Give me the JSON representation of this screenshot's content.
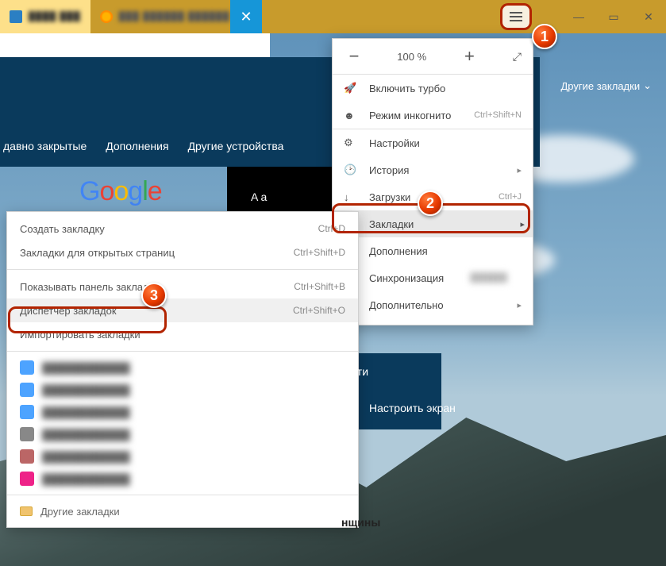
{
  "window": {
    "minimize": "—",
    "maximize": "▭",
    "close": "✕"
  },
  "hamburger_tooltip": "Меню",
  "tab_close_glyph": "✕",
  "zoom": {
    "minus": "−",
    "value": "100 %",
    "plus": "+",
    "full": "⤢"
  },
  "main_menu": {
    "turbo": {
      "icon": "🚀",
      "label": "Включить турбо"
    },
    "incognito": {
      "icon": "☻",
      "label": "Режим инкогнито",
      "sc": "Ctrl+Shift+N"
    },
    "settings": {
      "icon": "⚙",
      "label": "Настройки"
    },
    "history": {
      "icon": "🕑",
      "label": "История"
    },
    "downloads": {
      "icon": "↓",
      "label": "Загрузки",
      "sc": "Ctrl+J"
    },
    "bookmarks": {
      "icon": "☆",
      "label": "Закладки"
    },
    "addons": {
      "icon": "▦",
      "label": "Дополнения"
    },
    "sync": {
      "icon": "⟳",
      "label": "Синхронизация"
    },
    "more": {
      "icon": "⋯",
      "label": "Дополнительно"
    }
  },
  "submenu": {
    "create": {
      "label": "Создать закладку",
      "sc": "Ctrl+D"
    },
    "open_pages": {
      "label": "Закладки для открытых страниц",
      "sc": "Ctrl+Shift+D"
    },
    "show_panel": {
      "label": "Показывать панель закладок",
      "sc": "Ctrl+Shift+B"
    },
    "manager": {
      "label": "Диспетчер закладок",
      "sc": "Ctrl+Shift+O"
    },
    "import": {
      "label": "Импортировать закладки"
    },
    "other_folder": {
      "label": "Другие закладки"
    }
  },
  "nav": {
    "recently_closed": "давно закрытые",
    "addons": "Дополнения",
    "other_devices": "Другие устройства"
  },
  "other_bookmarks_dd": "Другие закладки",
  "black_strip_text": "A а",
  "fragments": {
    "osti": "ости",
    "configure_screen": "Настроить экран",
    "women": "нщины"
  },
  "bookmarks_list_placeholders": [
    {
      "color": "#4da3ff"
    },
    {
      "color": "#4da3ff"
    },
    {
      "color": "#4da3ff"
    },
    {
      "color": "#888"
    },
    {
      "color": "#b66"
    },
    {
      "color": "#e28"
    }
  ]
}
